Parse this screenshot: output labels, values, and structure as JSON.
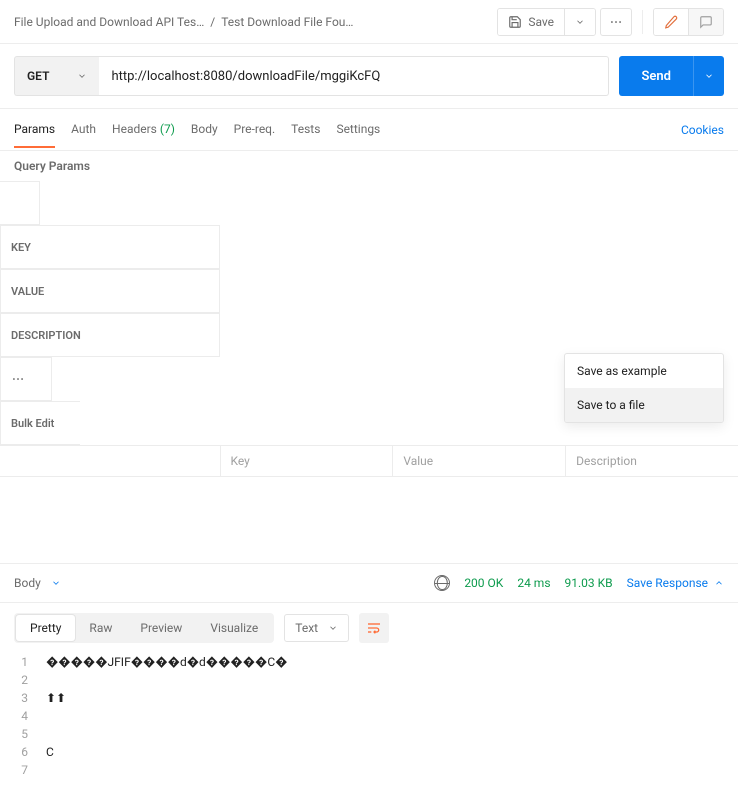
{
  "header": {
    "collection": "File Upload and Download API Tes…",
    "separator": "/",
    "current": "Test Download File Fou…",
    "save_label": "Save"
  },
  "request": {
    "method": "GET",
    "url": "http://localhost:8080/downloadFile/mggiKcFQ",
    "send_label": "Send"
  },
  "tabs": {
    "params": "Params",
    "auth": "Auth",
    "headers": "Headers",
    "headers_count": "(7)",
    "body": "Body",
    "prereq": "Pre-req.",
    "tests": "Tests",
    "settings": "Settings",
    "cookies": "Cookies"
  },
  "query_params": {
    "title": "Query Params",
    "col_key": "KEY",
    "col_value": "VALUE",
    "col_desc": "DESCRIPTION",
    "bulk": "Bulk Edit",
    "ph_key": "Key",
    "ph_value": "Value",
    "ph_desc": "Description"
  },
  "response": {
    "body_label": "Body",
    "status_code": "200",
    "status_text": "OK",
    "time": "24 ms",
    "size": "91.03 KB",
    "save_response": "Save Response"
  },
  "save_menu": {
    "example": "Save as example",
    "file": "Save to a file"
  },
  "viewer": {
    "pretty": "Pretty",
    "raw": "Raw",
    "preview": "Preview",
    "visualize": "Visualize",
    "format": "Text"
  },
  "body_lines": [
    "�����\u0010JFIF�\u0010�\u0010��d�d�����C�\u0011\u0012\u0012\u0012\u0012\u0012\u0012\u0012\u0012\u0012\u0012\u0012\u0012\u0012\u0012\u0012\u0012\u0012\u0012\u0012\u0012\u0012\u0012",
    "\u0012\u0012\u0012\u0012\u0012",
    "⬆⬆\u0012",
    "\u0012\u0012",
    "\u0012\u0012\u0012",
    "\u0012\u0012\u0012\u0012\u0012\u0012\u0012\u0012\u0012\u0012\u0012\u0012\u0012\u0012\u0012\u0012\u0012\u0012\u0012\u0012\u0012\u0012\u0012\u0012\u0012\u0012\u0012\u0012C\u0012\u0012\u0012\u0012\u0012\u0012\u0012\u0012   \u0012\u0012   \u0012",
    "\u0012"
  ]
}
